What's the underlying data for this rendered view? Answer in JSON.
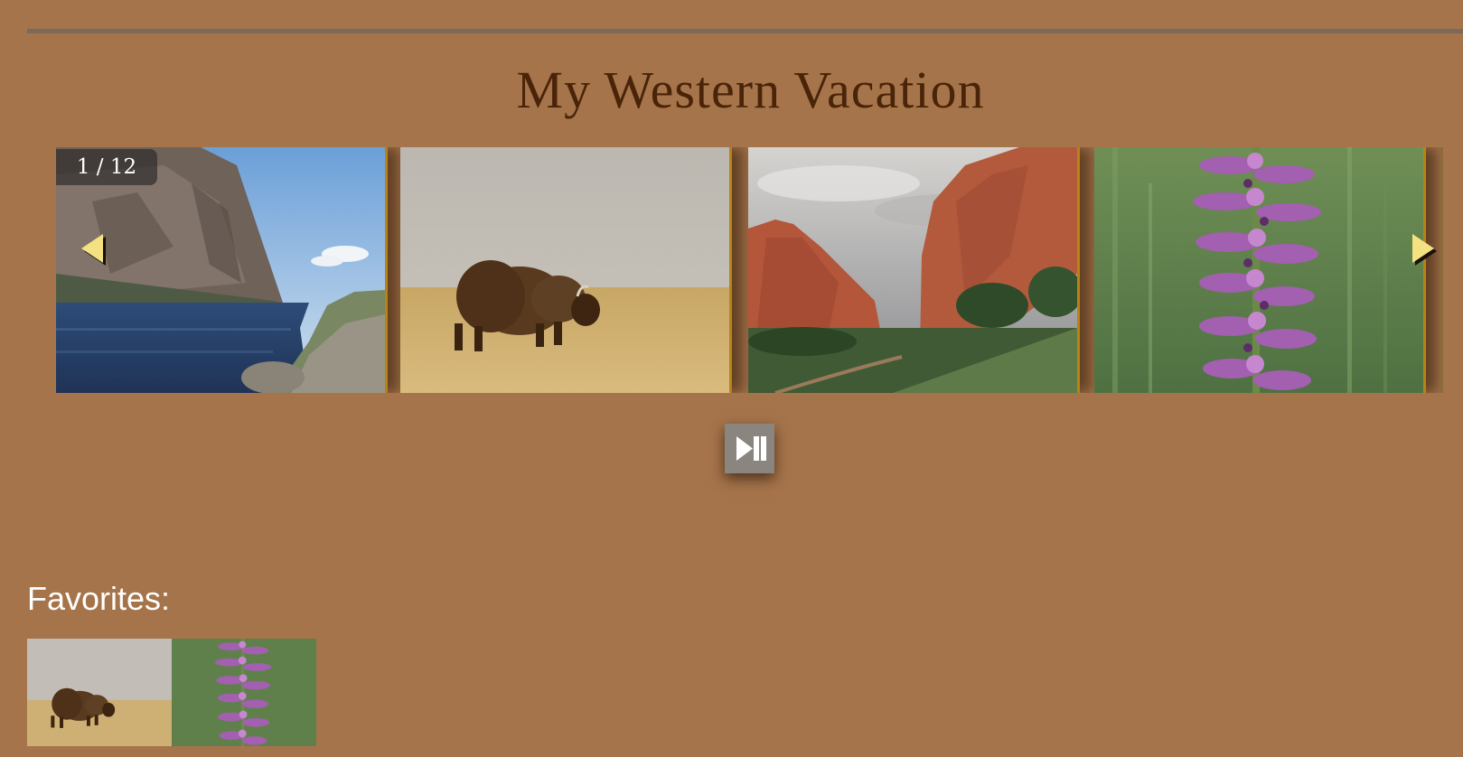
{
  "page": {
    "title": "My Western Vacation"
  },
  "slideshow": {
    "counter": "1 / 12",
    "current_index": 1,
    "total": 12,
    "slides": [
      {
        "subject": "mountain-lake-cliff"
      },
      {
        "subject": "bison-grassland"
      },
      {
        "subject": "red-rock-formations"
      },
      {
        "subject": "purple-orchid-flower"
      }
    ],
    "prev_icon": "triangle-left-icon",
    "next_icon": "triangle-right-icon",
    "play_pause_icon": "play-pause-icon"
  },
  "favorites": {
    "label": "Favorites:",
    "items": [
      {
        "subject": "bison-grassland"
      },
      {
        "subject": "purple-orchid-flower"
      }
    ]
  },
  "colors": {
    "background": "#a6744b",
    "title": "#4a2408",
    "arrow": "#f4e282",
    "slide_border": "#b98314",
    "button": "#8b8580"
  }
}
